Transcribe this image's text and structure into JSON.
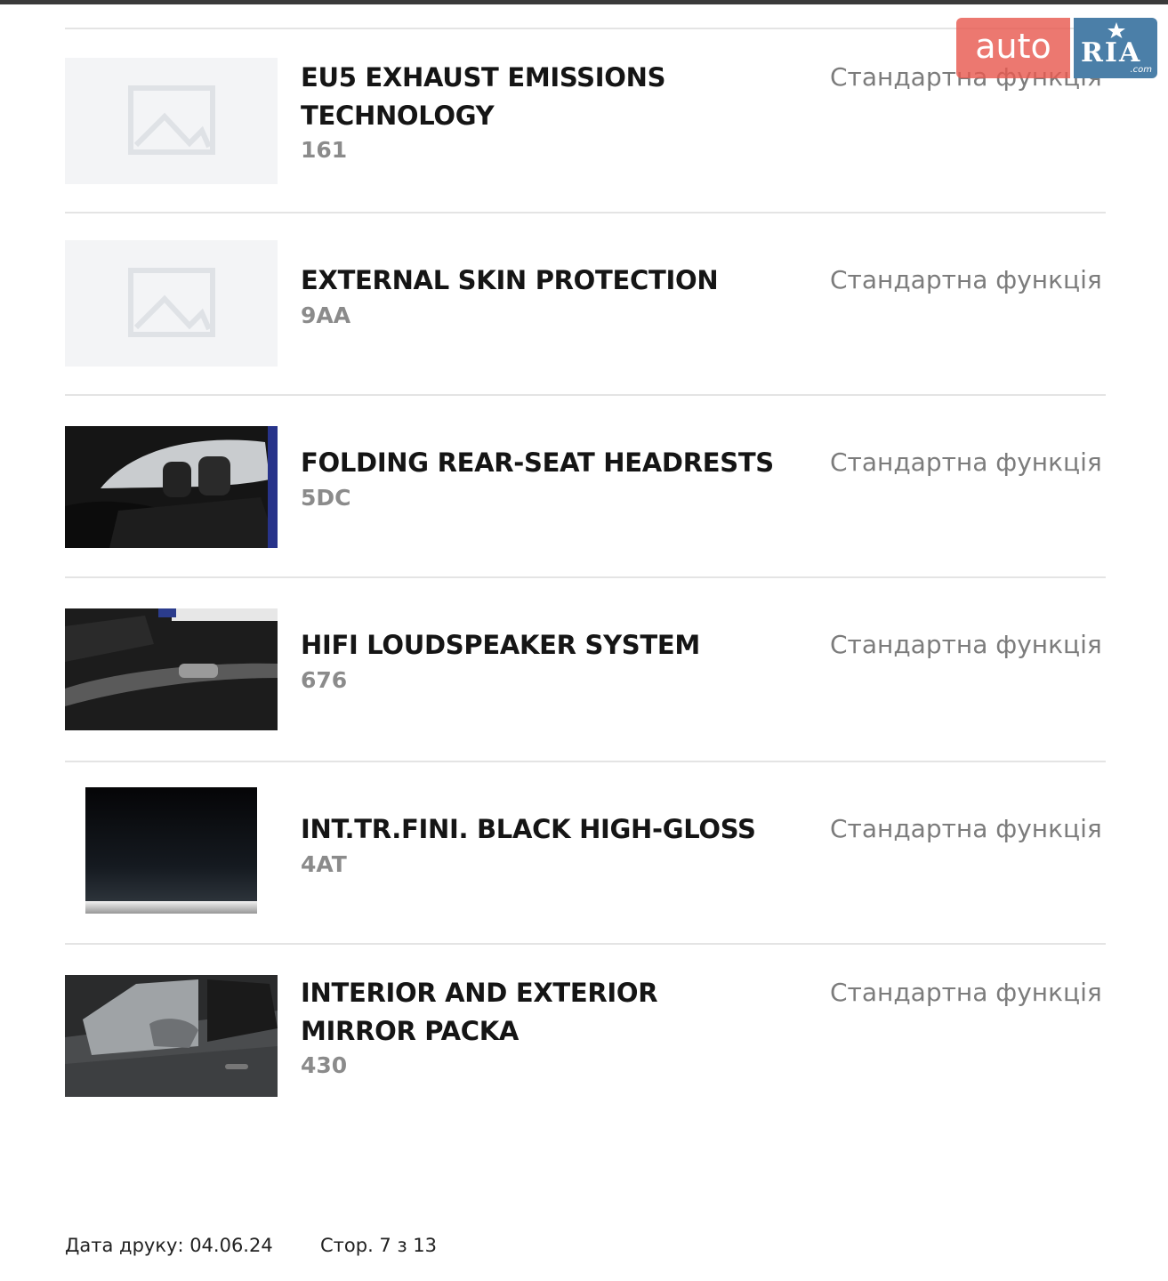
{
  "watermark": {
    "auto": "auto",
    "ria": "RIA",
    "com": ".com"
  },
  "items": [
    {
      "title_lines": [
        "EU5 EXHAUST EMISSIONS",
        "TECHNOLOGY"
      ],
      "code": "161",
      "status": "Стандартна функція",
      "image": "placeholder-image-icon"
    },
    {
      "title_lines": [
        "EXTERNAL SKIN PROTECTION"
      ],
      "code": "9AA",
      "status": "Стандартна функція",
      "image": "placeholder-image-icon"
    },
    {
      "title_lines": [
        "FOLDING REAR-SEAT HEADRESTS"
      ],
      "code": "5DC",
      "status": "Стандартна функція",
      "image": "rear-seat-headrests-photo"
    },
    {
      "title_lines": [
        "HIFI LOUDSPEAKER SYSTEM"
      ],
      "code": "676",
      "status": "Стандартна функція",
      "image": "door-panel-speaker-photo"
    },
    {
      "title_lines": [
        "INT.TR.FINI. BLACK HIGH-GLOSS"
      ],
      "code": "4AT",
      "status": "Стандартна функція",
      "image": "black-gloss-trim-swatch"
    },
    {
      "title_lines": [
        "INTERIOR AND EXTERIOR",
        "MIRROR PACKA"
      ],
      "code": "430",
      "status": "Стандартна функція",
      "image": "car-side-mirror-photo"
    }
  ],
  "footer": {
    "print_date": "Дата друку: 04.06.24",
    "page": "Стор. 7 з 13"
  }
}
